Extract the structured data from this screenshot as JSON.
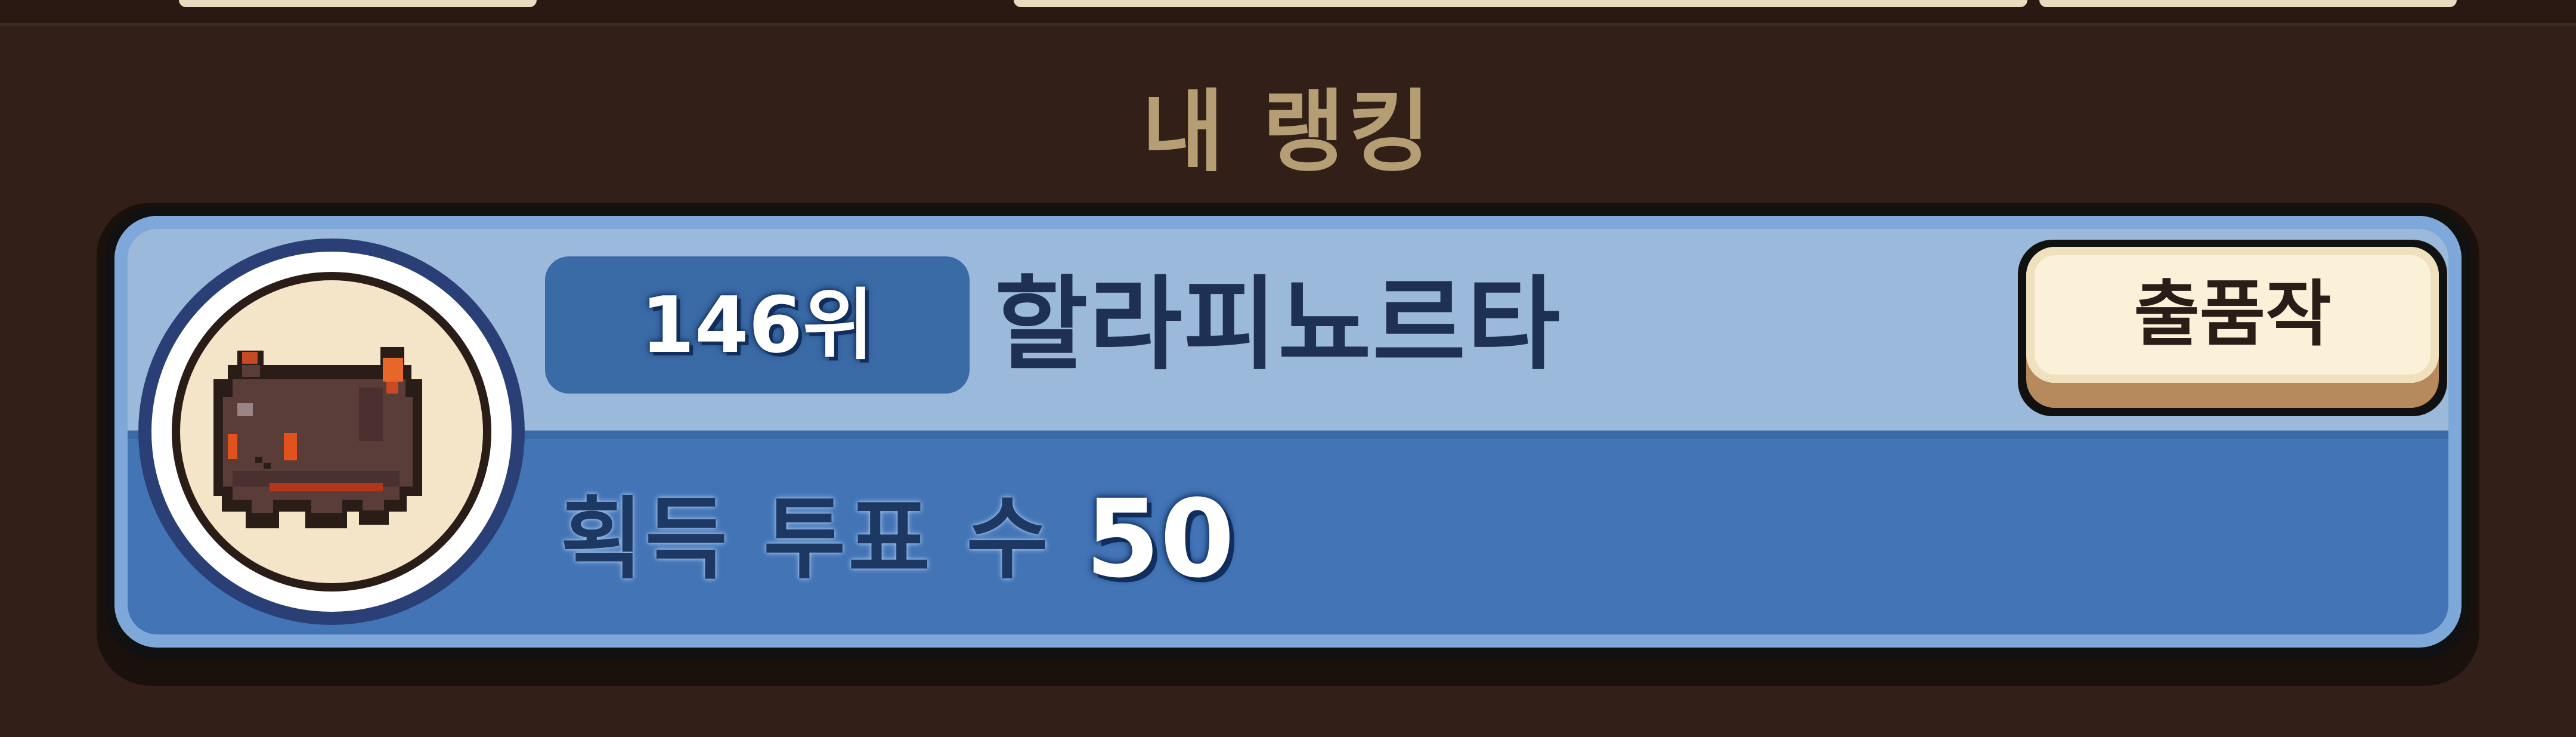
{
  "section": {
    "title": "내 랭킹"
  },
  "my_rank": {
    "rank_label": "146위",
    "name": "할라피뇨르타",
    "entry_button_label": "출품작",
    "votes_label": "획득 투표 수",
    "votes_value": "50",
    "avatar_icon": "pixel-cat-avatar-icon"
  },
  "colors": {
    "background": "#321f18",
    "title": "#b59d74",
    "card_upper": "#9bbadb",
    "card_lower": "#4274b6",
    "rank_badge": "#3b6ba6",
    "entry_button": "#fbf1d9"
  }
}
